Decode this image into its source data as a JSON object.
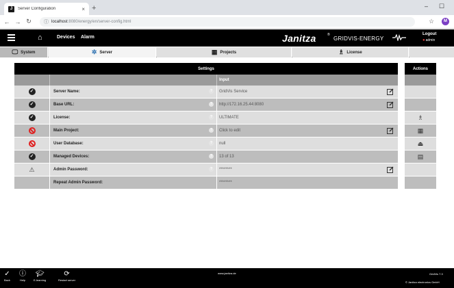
{
  "browser": {
    "tab_title": "Server Configuration",
    "tab_close": "×",
    "new_tab": "+",
    "url_host": "localhost",
    "url_path": ":8080/energy/en/server-config.html",
    "profile_initial": "M",
    "window_minimize": "–",
    "window_maximize": "☐"
  },
  "app": {
    "menu": {
      "devices": "Devices",
      "alarm": "Alarm"
    },
    "brand": "Janitza",
    "brand_sub": "GRIDVIS-ENERGY",
    "logout": "Logout",
    "user": "admin"
  },
  "tabs": {
    "system": "System",
    "server": "Server",
    "projects": "Projects",
    "license": "License"
  },
  "table": {
    "title": "Settings",
    "input_header": "Input",
    "rows": [
      {
        "label": "Server Name:",
        "value": "GridVis Service",
        "status": "ok",
        "editable": true,
        "help": true
      },
      {
        "label": "Base URL:",
        "value": "http://172.16.25.44:8080",
        "status": "ok",
        "editable": true,
        "help": true
      },
      {
        "label": "License:",
        "value": "ULTIMATE",
        "status": "ok",
        "editable": false,
        "help": true
      },
      {
        "label": "Main Project:",
        "value": "Click to edit",
        "status": "error",
        "editable": true,
        "help": true
      },
      {
        "label": "User Database:",
        "value": "null",
        "status": "error",
        "editable": false,
        "help": true
      },
      {
        "label": "Managed Devices:",
        "value": "13 of 13",
        "status": "ok",
        "editable": false,
        "help": true
      },
      {
        "label": "Admin Password:",
        "value": "********",
        "status": "warning",
        "editable": true,
        "help": true
      },
      {
        "label": "Repeat Admin Password:",
        "value": "********",
        "status": "none",
        "editable": false,
        "help": false
      }
    ]
  },
  "actions": {
    "title": "Actions",
    "row_icons": [
      "",
      "",
      "license-icon",
      "projects-icon",
      "upload-icon",
      "devices-icon",
      "",
      ""
    ]
  },
  "footer": {
    "back": "Back",
    "help": "Help",
    "elearning": "E-learning",
    "restart": "Restart server",
    "website": "www.janitza.de",
    "version": "GridVis 7.3",
    "copyright": "© Janitza electronics GmbH"
  }
}
